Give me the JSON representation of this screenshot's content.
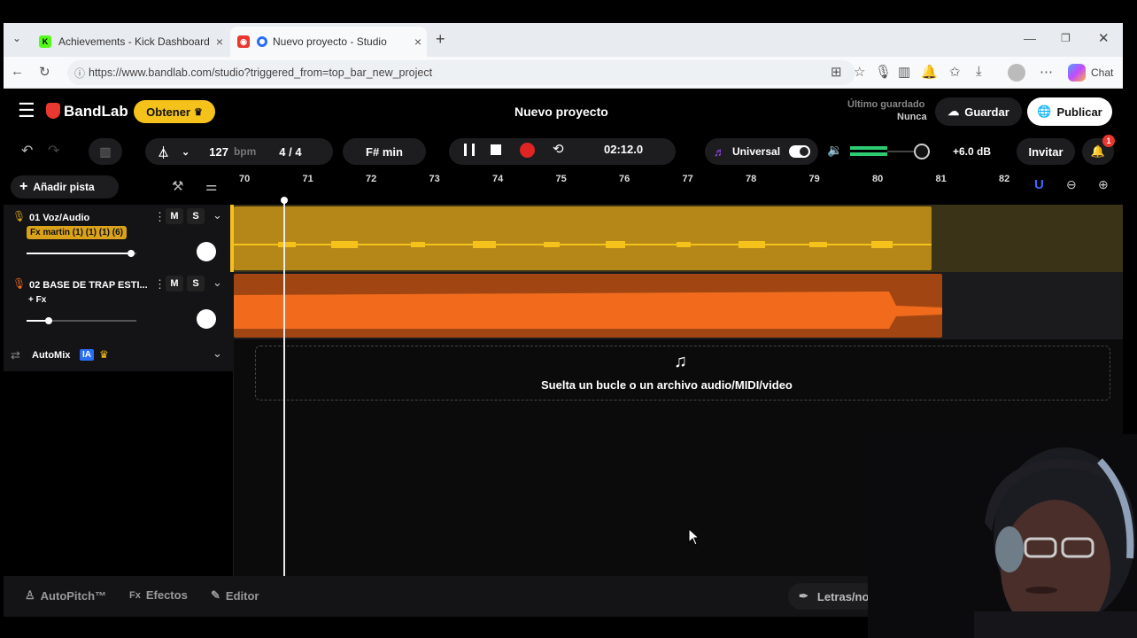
{
  "browser": {
    "tabs": [
      {
        "title": "Achievements - Kick Dashboard",
        "icon": "kick-logo-icon",
        "active": false
      },
      {
        "title": "Nuevo proyecto - Studio",
        "icon": "bandlab-logo-icon",
        "active": true
      }
    ],
    "url": "https://www.bandlab.com/studio?triggered_from=top_bar_new_project",
    "chat_label": "Chat"
  },
  "header": {
    "logo": "BandLab",
    "get_label": "Obtener",
    "project_title": "Nuevo proyecto",
    "last_saved_label": "Último guardado",
    "last_saved_value": "Nunca",
    "save_label": "Guardar",
    "publish_label": "Publicar"
  },
  "toolbar": {
    "bpm": "127",
    "bpm_unit": "bpm",
    "time_signature": "4 / 4",
    "key": "F# min",
    "time": "02:12.0",
    "preset": "Universal",
    "db": "+6.0 dB",
    "invite_label": "Invitar",
    "notification_count": "1"
  },
  "tracklist": {
    "add_track_label": "Añadir pista",
    "tracks": [
      {
        "number_name": "01  Voz/Audio",
        "fx": "Fx martin (1) (1) (1) (6)",
        "color": "#d9a21a",
        "volume": 0.95
      },
      {
        "number_name": "02  BASE DE TRAP ESTI...",
        "fx": "+ Fx",
        "color": "#f26b1d",
        "volume": 0.2
      }
    ],
    "mute_label": "M",
    "solo_label": "S",
    "automix_label": "AutoMix",
    "ia_badge": "IA"
  },
  "ruler": {
    "bars": [
      "70",
      "71",
      "72",
      "73",
      "74",
      "75",
      "76",
      "77",
      "78",
      "79",
      "80",
      "81",
      "82"
    ]
  },
  "drop_zone": {
    "text": "Suelta un bucle o un archivo audio/MIDI/video"
  },
  "bottom": {
    "autopitch": "AutoPitch™",
    "effects": "Efectos",
    "editor": "Editor",
    "lyrics": "Letras/no"
  },
  "colors": {
    "accent_yellow": "#f4c21b",
    "track1": "#d9a21a",
    "track2": "#f26b1d",
    "record": "#e02424"
  }
}
